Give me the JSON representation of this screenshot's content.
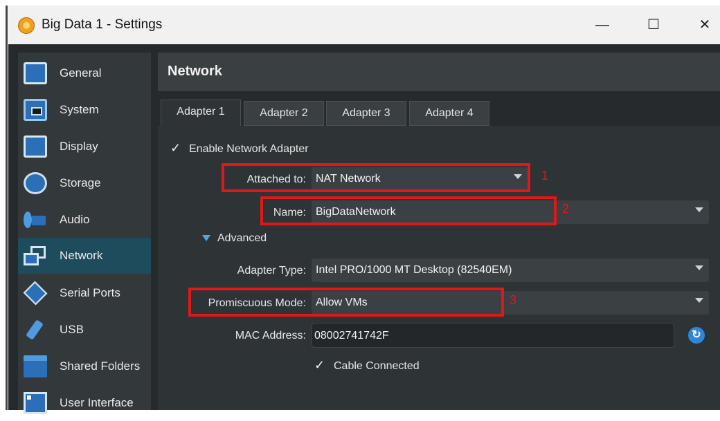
{
  "window": {
    "title": "Big Data 1 - Settings",
    "minimize_glyph": "—",
    "maximize_glyph": "☐",
    "close_glyph": "✕"
  },
  "sidebar": {
    "items": [
      {
        "label": "General",
        "icon": "monitor-icon"
      },
      {
        "label": "System",
        "icon": "chip-icon"
      },
      {
        "label": "Display",
        "icon": "display-icon"
      },
      {
        "label": "Storage",
        "icon": "disk-icon"
      },
      {
        "label": "Audio",
        "icon": "speaker-icon"
      },
      {
        "label": "Network",
        "icon": "network-icon",
        "active": true
      },
      {
        "label": "Serial Ports",
        "icon": "serial-port-icon"
      },
      {
        "label": "USB",
        "icon": "usb-icon"
      },
      {
        "label": "Shared Folders",
        "icon": "folder-icon"
      },
      {
        "label": "User Interface",
        "icon": "user-interface-icon"
      }
    ]
  },
  "panel": {
    "title": "Network",
    "tabs": [
      "Adapter 1",
      "Adapter 2",
      "Adapter 3",
      "Adapter 4"
    ],
    "active_tab": "Adapter 1",
    "enable_adapter": {
      "checked": true,
      "label": "Enable Network Adapter",
      "mark": "✓"
    },
    "attached_to": {
      "label": "Attached to:",
      "value": "NAT Network"
    },
    "name": {
      "label": "Name:",
      "value": "BigDataNetwork"
    },
    "advanced": {
      "label": "Advanced",
      "expanded": true
    },
    "adapter_type": {
      "label": "Adapter Type:",
      "value": "Intel PRO/1000 MT Desktop (82540EM)"
    },
    "promiscuous_mode": {
      "label": "Promiscuous Mode:",
      "value": "Allow VMs"
    },
    "mac_address": {
      "label": "MAC Address:",
      "value": "08002741742F",
      "refresh_glyph": "↻"
    },
    "cable_connected": {
      "checked": true,
      "label": "Cable Connected",
      "mark": "✓"
    }
  },
  "annotations": [
    "1",
    "2",
    "3"
  ],
  "colors": {
    "accent": "#1f4c5c",
    "annotation": "#e01818"
  }
}
